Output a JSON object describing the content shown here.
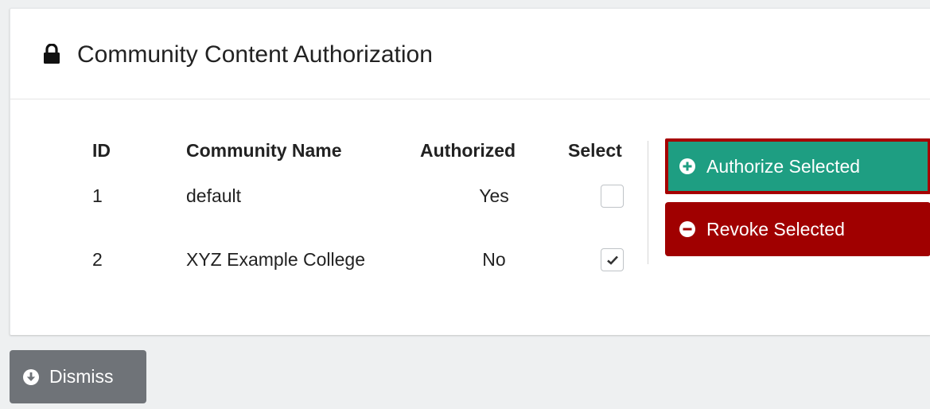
{
  "panel": {
    "title": "Community Content Authorization",
    "title_icon": "lock-icon"
  },
  "table": {
    "columns": [
      "ID",
      "Community Name",
      "Authorized",
      "Select"
    ],
    "rows": [
      {
        "id": "1",
        "name": "default",
        "authorized": "Yes",
        "selected": false
      },
      {
        "id": "2",
        "name": "XYZ Example College",
        "authorized": "No",
        "selected": true
      }
    ]
  },
  "actions": {
    "authorize_label": "Authorize Selected",
    "authorize_icon": "plus-circle-icon",
    "revoke_label": "Revoke Selected",
    "revoke_icon": "minus-circle-icon"
  },
  "footer": {
    "dismiss_label": "Dismiss",
    "dismiss_icon": "arrow-down-circle-icon"
  },
  "colors": {
    "authorize": "#1e9e82",
    "authorize_outline": "#a60000",
    "revoke": "#a00000",
    "dismiss": "#6f7378",
    "background": "#eef0f1"
  }
}
